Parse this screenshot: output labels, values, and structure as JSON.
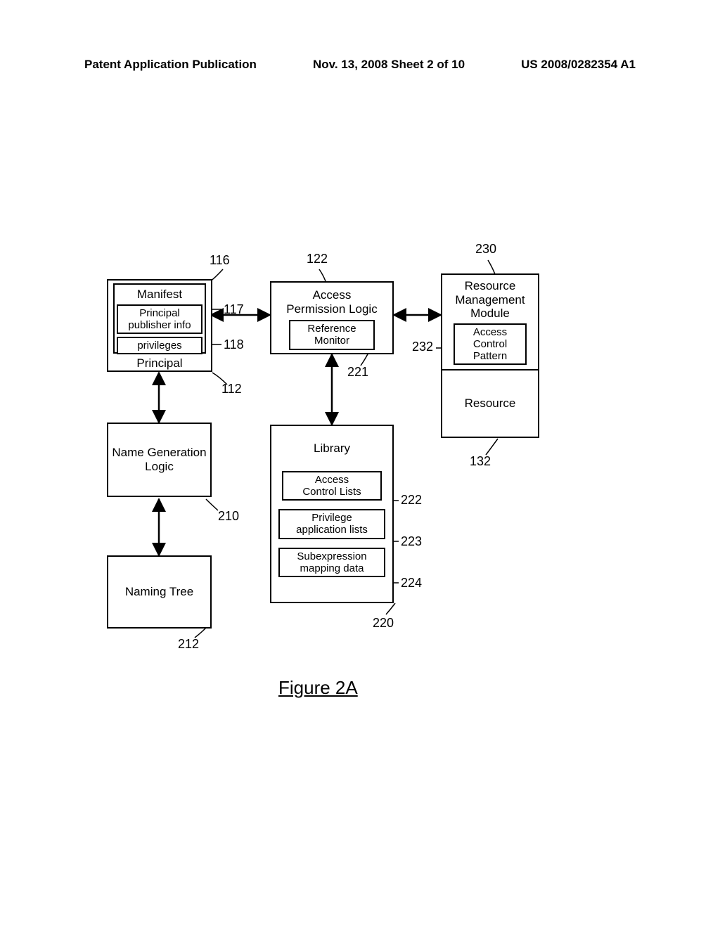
{
  "header": {
    "left": "Patent Application Publication",
    "center": "Nov. 13, 2008  Sheet 2 of 10",
    "right": "US 2008/0282354 A1"
  },
  "boxes": {
    "principal": {
      "label": "Principal"
    },
    "manifest": {
      "label": "Manifest"
    },
    "principal_publisher": {
      "label": "Principal\npublisher info"
    },
    "privileges": {
      "label": "privileges"
    },
    "apl": {
      "label": "Access\nPermission Logic"
    },
    "ref_monitor": {
      "label": "Reference\nMonitor"
    },
    "rmm": {
      "label": "Resource\nManagement\nModule"
    },
    "acp": {
      "label": "Access\nControl\nPattern"
    },
    "resource": {
      "label": "Resource"
    },
    "ngl": {
      "label": "Name Generation\nLogic"
    },
    "naming_tree": {
      "label": "Naming Tree"
    },
    "library": {
      "label": "Library"
    },
    "acl": {
      "label": "Access\nControl Lists"
    },
    "pal": {
      "label": "Privilege\napplication lists"
    },
    "smd": {
      "label": "Subexpression\nmapping data"
    }
  },
  "refs": {
    "r116": "116",
    "r117": "117",
    "r118": "118",
    "r112": "112",
    "r122": "122",
    "r221": "221",
    "r230": "230",
    "r232": "232",
    "r132": "132",
    "r210": "210",
    "r212": "212",
    "r220": "220",
    "r222": "222",
    "r223": "223",
    "r224": "224"
  },
  "figure": "Figure 2A"
}
